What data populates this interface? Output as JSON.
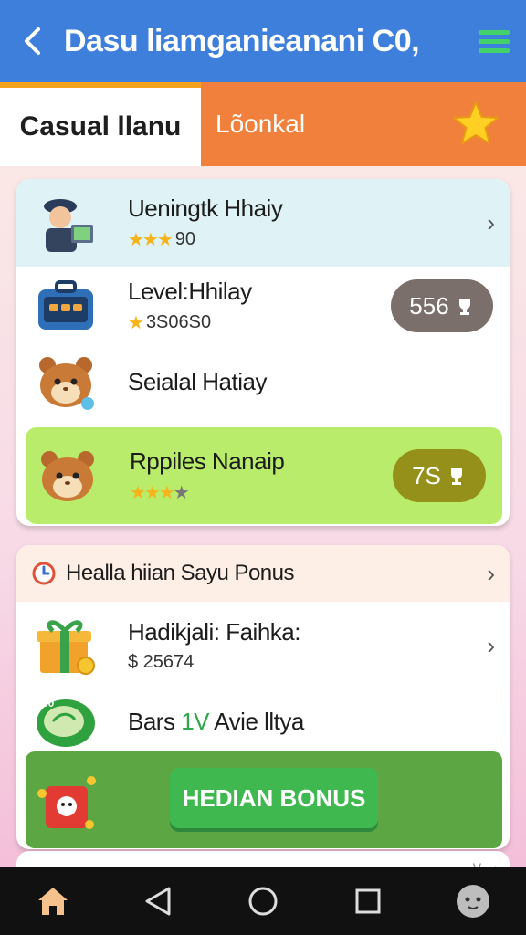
{
  "appbar": {
    "title": "Dasu liamganieanani C0,",
    "back_icon": "chevron-left-icon",
    "menu_icon": "hamburger-menu-icon"
  },
  "tabs": {
    "left_label": "Casual llanu",
    "right_label": "Lõonkal",
    "star_icon": "star-icon"
  },
  "leaderboard": {
    "rows": [
      {
        "name": "Ueningtk Hhaiy",
        "rating": "90",
        "stars": 3,
        "icon": "detective-avatar-icon"
      },
      {
        "name": "Level:Hhilay",
        "rating": "3S06S0",
        "stars": 1,
        "badge": "556",
        "icon": "briefcase-avatar-icon"
      },
      {
        "name": "Seialal Hatiay",
        "icon": "hamster-avatar-icon"
      },
      {
        "name": "Rppiles Nanaip",
        "stars": 3,
        "stars_total": 4,
        "badge": "7S",
        "icon": "hamster-avatar-icon"
      }
    ]
  },
  "bonus": {
    "header": "Healla hiian Sayu Ponus",
    "rows": [
      {
        "name": "Hadikjali: Faihka:",
        "value": "$ 25674",
        "icon": "gift-box-icon"
      },
      {
        "name_prefix": "Bars ",
        "name_accent": "1V",
        "name_suffix": " Avie lltya",
        "icon": "coin-icon"
      }
    ],
    "button_label": "HEDIAN BONUS",
    "accent_color": "#2ea84a"
  },
  "peek_label": "V... ›",
  "colors": {
    "appbar": "#3f7fdc",
    "tab_accent": "#f0803c",
    "highlight_row": "#b9ec6a",
    "bonus_bar": "#5da644"
  },
  "navbar": {
    "items": [
      "home-icon",
      "back-icon",
      "circle-home-icon",
      "square-recents-icon",
      "assistant-face-icon"
    ]
  }
}
